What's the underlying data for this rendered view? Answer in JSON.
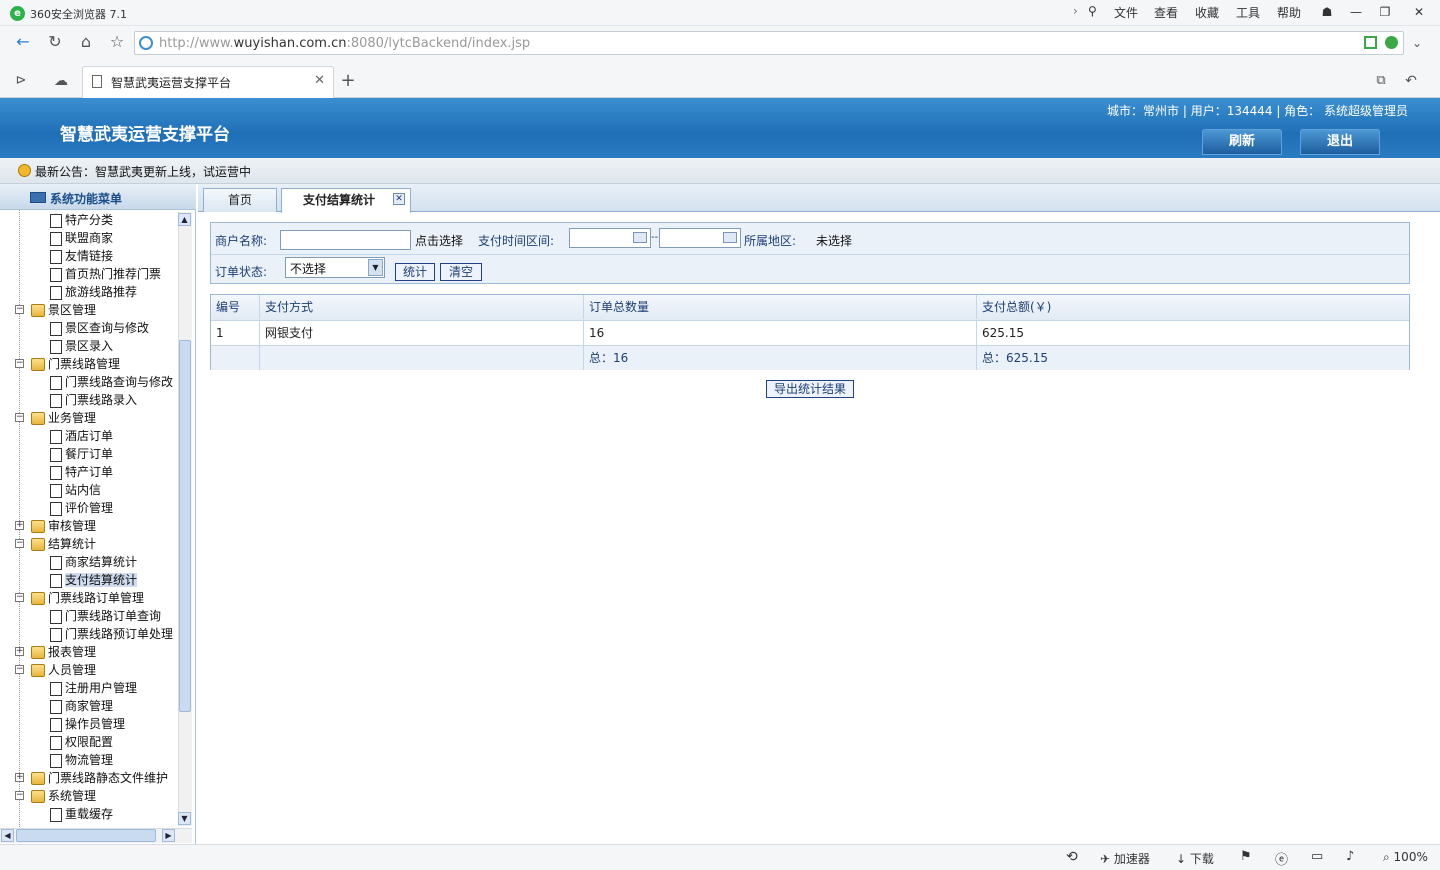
{
  "browser": {
    "title": "360安全浏览器 7.1",
    "menu": [
      "文件",
      "查看",
      "收藏",
      "工具",
      "帮助"
    ],
    "url_prefix": "http://www.",
    "url_domain": "wuyishan.com.cn",
    "url_suffix": ":8080/lytcBackend/index.jsp",
    "tab_title": "智慧武夷运营支撑平台",
    "status": {
      "accelerator": "加速器",
      "download": "下载",
      "zoom": "100%"
    }
  },
  "header": {
    "system_title": "智慧武夷运营支撑平台",
    "user_info": "城市：常州市  | 用户：134444 |  角色：  系统超级管理员",
    "refresh_label": "刷新",
    "logout_label": "退出"
  },
  "notice": {
    "text": "最新公告：智慧武夷更新上线，试运营中"
  },
  "sidebar": {
    "title": "系统功能菜单",
    "tree": [
      {
        "label": "特产分类",
        "type": "doc",
        "level": 2
      },
      {
        "label": "联盟商家",
        "type": "doc",
        "level": 2
      },
      {
        "label": "友情链接",
        "type": "doc",
        "level": 2
      },
      {
        "label": "首页热门推荐门票",
        "type": "doc",
        "level": 2
      },
      {
        "label": "旅游线路推荐",
        "type": "doc",
        "level": 2
      },
      {
        "label": "景区管理",
        "type": "folder",
        "level": 1,
        "expanded": true
      },
      {
        "label": "景区查询与修改",
        "type": "doc",
        "level": 2
      },
      {
        "label": "景区录入",
        "type": "doc",
        "level": 2
      },
      {
        "label": "门票线路管理",
        "type": "folder",
        "level": 1,
        "expanded": true
      },
      {
        "label": "门票线路查询与修改",
        "type": "doc",
        "level": 2
      },
      {
        "label": "门票线路录入",
        "type": "doc",
        "level": 2
      },
      {
        "label": "业务管理",
        "type": "folder",
        "level": 1,
        "expanded": true
      },
      {
        "label": "酒店订单",
        "type": "doc",
        "level": 2
      },
      {
        "label": "餐厅订单",
        "type": "doc",
        "level": 2
      },
      {
        "label": "特产订单",
        "type": "doc",
        "level": 2
      },
      {
        "label": "站内信",
        "type": "doc",
        "level": 2
      },
      {
        "label": "评价管理",
        "type": "doc",
        "level": 2
      },
      {
        "label": "审核管理",
        "type": "folder",
        "level": 1,
        "expanded": false
      },
      {
        "label": "结算统计",
        "type": "folder",
        "level": 1,
        "expanded": true
      },
      {
        "label": "商家结算统计",
        "type": "doc",
        "level": 2
      },
      {
        "label": "支付结算统计",
        "type": "doc",
        "level": 2,
        "selected": true
      },
      {
        "label": "门票线路订单管理",
        "type": "folder",
        "level": 1,
        "expanded": true
      },
      {
        "label": "门票线路订单查询",
        "type": "doc",
        "level": 2
      },
      {
        "label": "门票线路预订单处理",
        "type": "doc",
        "level": 2
      },
      {
        "label": "报表管理",
        "type": "folder",
        "level": 1,
        "expanded": false
      },
      {
        "label": "人员管理",
        "type": "folder",
        "level": 1,
        "expanded": true
      },
      {
        "label": "注册用户管理",
        "type": "doc",
        "level": 2
      },
      {
        "label": "商家管理",
        "type": "doc",
        "level": 2
      },
      {
        "label": "操作员管理",
        "type": "doc",
        "level": 2
      },
      {
        "label": "权限配置",
        "type": "doc",
        "level": 2
      },
      {
        "label": "物流管理",
        "type": "doc",
        "level": 2
      },
      {
        "label": "门票线路静态文件维护",
        "type": "folder",
        "level": 1,
        "expanded": false
      },
      {
        "label": "系统管理",
        "type": "folder",
        "level": 1,
        "expanded": true
      },
      {
        "label": "重载缓存",
        "type": "doc",
        "level": 2
      }
    ]
  },
  "content_tabs": {
    "home": "首页",
    "active": "支付结算统计"
  },
  "form": {
    "merchant_label": "商户名称:",
    "merchant_value": "",
    "click_select": "点击选择",
    "pay_time_label": "支付时间区间:",
    "date_start": "",
    "date_sep": "--",
    "date_end": "",
    "region_label": "所属地区:",
    "region_value": "未选择",
    "order_status_label": "订单状态:",
    "order_status_value": "不选择",
    "stat_button": "统计",
    "clear_button": "清空"
  },
  "table": {
    "headers": [
      "编号",
      "支付方式",
      "订单总数量",
      "支付总额(￥)"
    ],
    "rows": [
      [
        "1",
        "网银支付",
        "16",
        "625.15"
      ]
    ],
    "footer": [
      "",
      "",
      "总：16",
      "总：625.15"
    ]
  },
  "export_button": "导出统计结果"
}
